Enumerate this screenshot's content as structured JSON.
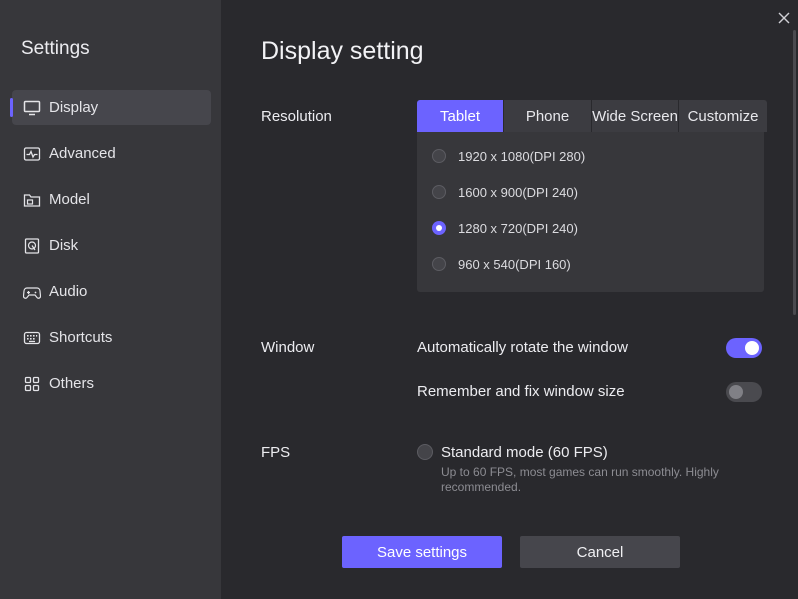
{
  "sidebar": {
    "title": "Settings",
    "items": [
      {
        "label": "Display",
        "icon": "monitor-icon",
        "active": true
      },
      {
        "label": "Advanced",
        "icon": "pulse-icon",
        "active": false
      },
      {
        "label": "Model",
        "icon": "folder-icon",
        "active": false
      },
      {
        "label": "Disk",
        "icon": "disk-icon",
        "active": false
      },
      {
        "label": "Audio",
        "icon": "gamepad-icon",
        "active": false
      },
      {
        "label": "Shortcuts",
        "icon": "keyboard-icon",
        "active": false
      },
      {
        "label": "Others",
        "icon": "grid-icon",
        "active": false
      }
    ]
  },
  "main": {
    "title": "Display setting",
    "resolution": {
      "label": "Resolution",
      "tabs": [
        "Tablet",
        "Phone",
        "Wide Screen",
        "Customize"
      ],
      "active_tab": "Tablet",
      "options": [
        {
          "label": "1920 x 1080(DPI 280)",
          "checked": false
        },
        {
          "label": "1600 x 900(DPI 240)",
          "checked": false
        },
        {
          "label": "1280 x 720(DPI 240)",
          "checked": true
        },
        {
          "label": "960 x 540(DPI 160)",
          "checked": false
        }
      ]
    },
    "window": {
      "label": "Window",
      "options": [
        {
          "label": "Automatically rotate the window",
          "on": true
        },
        {
          "label": "Remember and fix window size",
          "on": false
        }
      ]
    },
    "fps": {
      "label": "FPS",
      "option": "Standard mode (60 FPS)",
      "description": "Up to 60 FPS, most games can run smoothly. Highly recommended."
    }
  },
  "buttons": {
    "save": "Save settings",
    "cancel": "Cancel"
  },
  "colors": {
    "accent": "#6c63ff",
    "sidebar": "#37373b",
    "background": "#29292d"
  }
}
